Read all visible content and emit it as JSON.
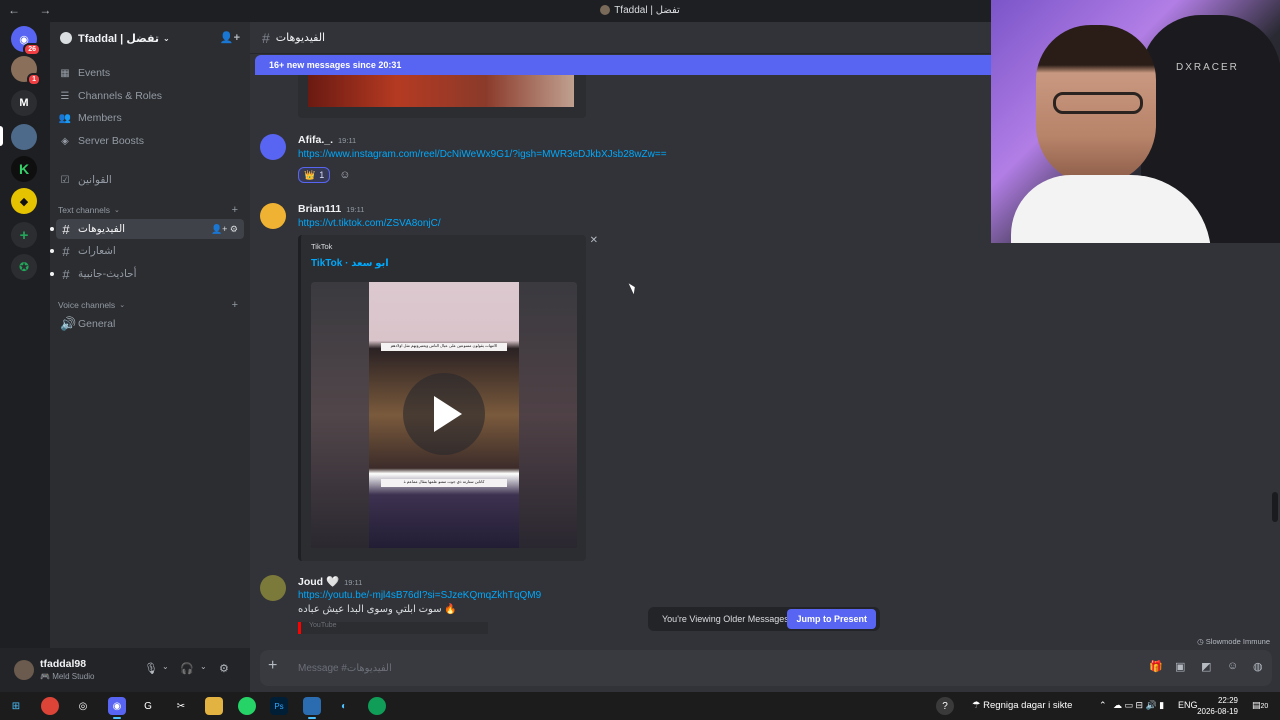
{
  "window": {
    "title": "Tfaddal | تفضل",
    "nav_arrows": "← →"
  },
  "rail": {
    "dm_badge": "26",
    "server_badge": "1",
    "letter_server": "M",
    "add_icon": "plus-icon",
    "explore_icon": "compass-icon"
  },
  "guild": {
    "name": "Tfaddal | تفضل",
    "nav": [
      {
        "label": "Events",
        "icon": "calendar-icon"
      },
      {
        "label": "Channels & Roles",
        "icon": "list-icon"
      },
      {
        "label": "Members",
        "icon": "members-icon"
      },
      {
        "label": "Server Boosts",
        "icon": "boost-icon"
      }
    ],
    "rules_channel": "القوانين",
    "text_category": "Text channels",
    "text_channels": [
      "الفيديوهات",
      "اشعارات",
      "أحاديث-جانبية"
    ],
    "voice_category": "Voice channels",
    "voice_channels": [
      "General"
    ]
  },
  "user": {
    "name": "tfaddal98",
    "status": "Meld Studio"
  },
  "chat": {
    "channel": "الفيديوهات",
    "new_messages": "16+ new messages since 20:31",
    "messages": [
      {
        "author": "Afifa._.",
        "time": "19:11",
        "link": "https://www.instagram.com/reel/DcNiWeWx9G1/?igsh=MWR3eDJkbXJsb28wZw==",
        "reaction_emoji": "👑",
        "reaction_count": "1"
      },
      {
        "author": "Brian111",
        "time": "19:11",
        "link": "https://vt.tiktok.com/ZSVA8onjC/",
        "embed_provider": "TikTok",
        "embed_title": "TikTok · ابو سعد",
        "caption_top": "الامهات يقولون ممنوعين على عيال الناس ويعتبرونهم مثل اولادهم",
        "caption_bottom": "كاتابن ستارته ذي جوت ممنو علمها بنقال مماعم ة"
      },
      {
        "author": "Joud 🤍",
        "time": "19:11",
        "link": "https://youtu.be/-mjl4sB76dI?si=SJzeKQmqZkhTqQM9",
        "text": "سوت ابلتي وسوى البدا عيش عباده 🔥",
        "embed_provider": "YouTube"
      }
    ],
    "older_notice": "You're Viewing Older Messages",
    "jump_label": "Jump to Present",
    "slowmode": "Slowmode Immune",
    "composer_placeholder": "Message #الفيديوهات"
  },
  "cam": {
    "chair_brand": "DXRACER"
  },
  "taskbar": {
    "weather": "Regniga dagar i sikte",
    "lang": "ENG",
    "time": "22:29",
    "date": "2026-08-19",
    "notifications": "20"
  }
}
